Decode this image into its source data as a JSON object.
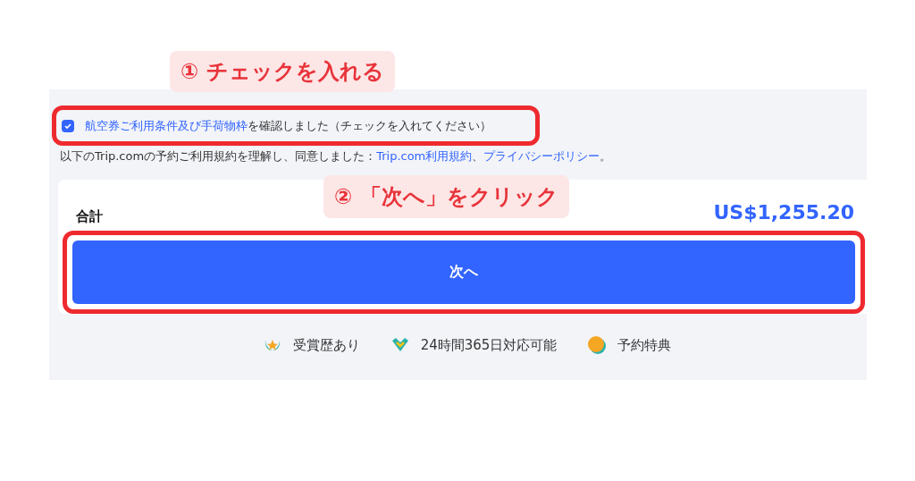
{
  "consent": {
    "checked": true,
    "link": "航空券ご利用条件及び手荷物枠",
    "text": "を確認しました（チェックを入れてください）"
  },
  "agreement": {
    "text": "以下のTrip.comの予約ご利用規約を理解し、同意しました：",
    "links": [
      "Trip.com利用規約",
      "、",
      "プライバシーポリシー",
      "。"
    ]
  },
  "total": {
    "label": "合計",
    "amount": "US$1,255.20"
  },
  "next_button": "次へ",
  "features": [
    {
      "kind": "award",
      "label": "受賞歴あり"
    },
    {
      "kind": "support",
      "label": "24時間365日対応可能"
    },
    {
      "kind": "coin",
      "label": "予約特典"
    }
  ],
  "annotations": [
    "① チェックを入れる",
    "② 「次へ」をクリック"
  ]
}
